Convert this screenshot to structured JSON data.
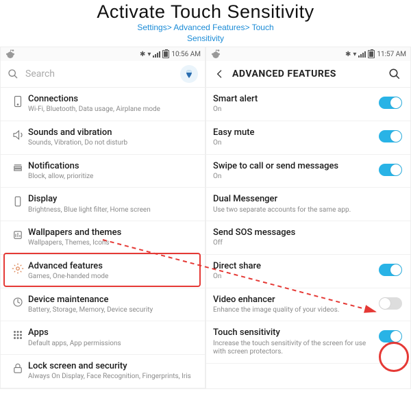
{
  "header": {
    "title": "Activate Touch Sensitivity",
    "path1": "Settings> Advanced Features> Touch",
    "path2": "Sensitivity"
  },
  "left": {
    "time": "10:56 AM",
    "search_placeholder": "Search",
    "items": [
      {
        "label": "Connections",
        "sub": "Wi-Fi, Bluetooth, Data usage, Airplane mode"
      },
      {
        "label": "Sounds and vibration",
        "sub": "Sounds, Vibration, Do not disturb"
      },
      {
        "label": "Notifications",
        "sub": "Block, allow, prioritize"
      },
      {
        "label": "Display",
        "sub": "Brightness, Blue light filter, Home screen"
      },
      {
        "label": "Wallpapers and themes",
        "sub": "Wallpapers, Themes, Icons"
      },
      {
        "label": "Advanced features",
        "sub": "Games, One-handed mode"
      },
      {
        "label": "Device maintenance",
        "sub": "Battery, Storage, Memory, Device security"
      },
      {
        "label": "Apps",
        "sub": "Default apps, App permissions"
      },
      {
        "label": "Lock screen and security",
        "sub": "Always On Display, Face Recognition, Fingerprints, Iris"
      }
    ]
  },
  "right": {
    "time": "11:57 AM",
    "title": "ADVANCED FEATURES",
    "items": [
      {
        "label": "Smart alert",
        "sub": "On",
        "toggle": "on"
      },
      {
        "label": "Easy mute",
        "sub": "On",
        "toggle": "on"
      },
      {
        "label": "Swipe to call or send messages",
        "sub": "On",
        "toggle": "on"
      },
      {
        "label": "Dual Messenger",
        "sub": "Use two separate accounts for the same app."
      },
      {
        "label": "Send SOS messages",
        "sub": "Off"
      },
      {
        "label": "Direct share",
        "sub": "On",
        "toggle": "on"
      },
      {
        "label": "Video enhancer",
        "sub": "Enhance the image quality of your videos.",
        "toggle": "off"
      },
      {
        "label": "Touch sensitivity",
        "sub": "Increase the touch sensitivity of the screen for use with screen protectors.",
        "toggle": "on"
      }
    ]
  }
}
